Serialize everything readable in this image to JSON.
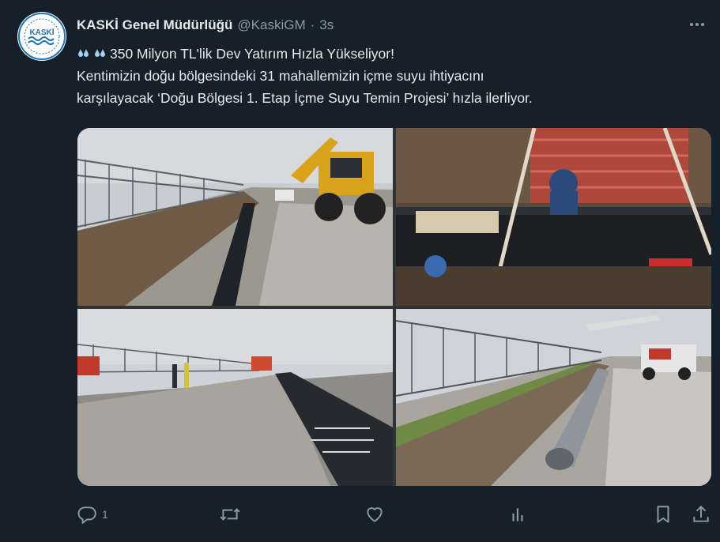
{
  "tweet": {
    "display_name": "KASKİ Genel Müdürlüğü",
    "handle": "@KaskiGM",
    "separator": "·",
    "time": "3s",
    "avatar_text": "KASKİ",
    "lines": [
      "350 Milyon TL'lik Dev Yatırım Hızla Yükseliyor!",
      "Kentimizin doğu bölgesindeki 31 mahallemizin içme suyu ihtiyacını",
      "karşılayacak ‘Doğu Bölgesi 1. Etap İçme Suyu Temin Projesi’ hızla ilerliyor."
    ],
    "emoji_icons": [
      "water-drop-icon",
      "water-drop-icon"
    ]
  },
  "actions": {
    "reply_count": "1",
    "retweet_count": "",
    "like_count": "",
    "views_count": ""
  },
  "colors": {
    "background": "#15202b",
    "text": "#e7e9ea",
    "muted": "#8b98a5"
  }
}
